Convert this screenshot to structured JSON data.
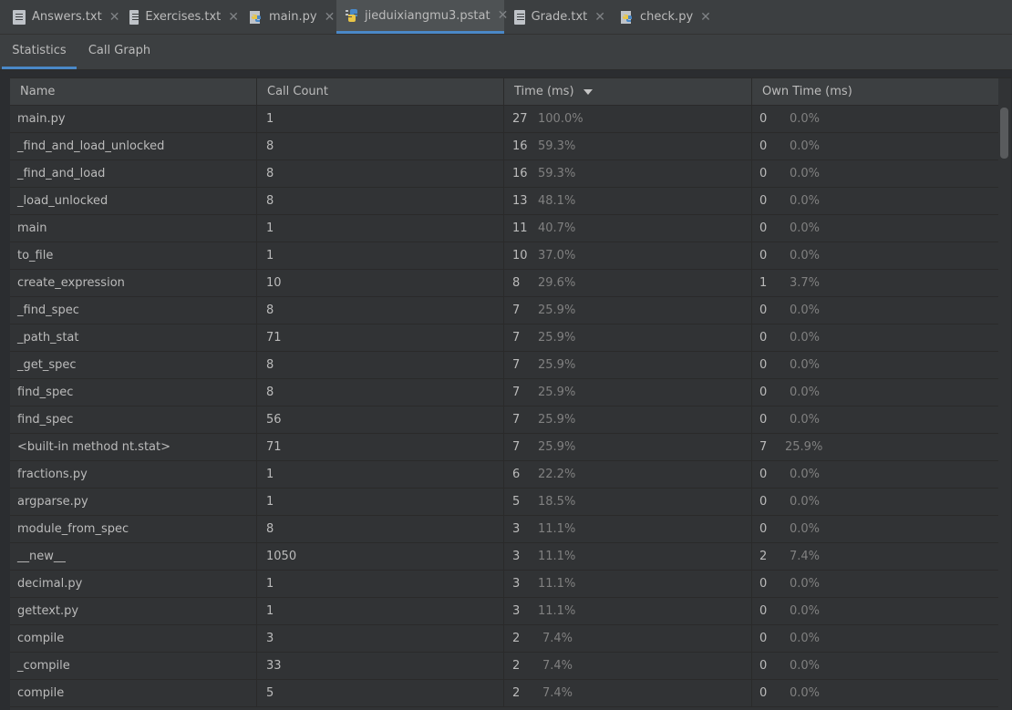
{
  "editor_tabs": [
    {
      "label": "Answers.txt",
      "icon": "text-file-icon"
    },
    {
      "label": "Exercises.txt",
      "icon": "text-file-icon"
    },
    {
      "label": "main.py",
      "icon": "python-file-icon"
    },
    {
      "label": "jieduixiangmu3.pstat",
      "icon": "python-profile-icon",
      "active": true
    },
    {
      "label": "Grade.txt",
      "icon": "text-file-icon"
    },
    {
      "label": "check.py",
      "icon": "python-file-icon"
    }
  ],
  "close_glyph": "✕",
  "view_tabs": [
    {
      "label": "Statistics",
      "active": true
    },
    {
      "label": "Call Graph",
      "active": false
    }
  ],
  "table": {
    "columns": [
      "Name",
      "Call Count",
      "Time (ms)",
      "Own Time (ms)"
    ],
    "sorted_column": "Time (ms)",
    "sort_direction": "descending",
    "rows": [
      {
        "name": "main.py",
        "calls": "1",
        "time": "27",
        "time_pct": "100.0%",
        "own": "0",
        "own_pct": "0.0%"
      },
      {
        "name": "_find_and_load_unlocked",
        "calls": "8",
        "time": "16",
        "time_pct": "59.3%",
        "own": "0",
        "own_pct": "0.0%"
      },
      {
        "name": "_find_and_load",
        "calls": "8",
        "time": "16",
        "time_pct": "59.3%",
        "own": "0",
        "own_pct": "0.0%"
      },
      {
        "name": "_load_unlocked",
        "calls": "8",
        "time": "13",
        "time_pct": "48.1%",
        "own": "0",
        "own_pct": "0.0%"
      },
      {
        "name": "main",
        "calls": "1",
        "time": "11",
        "time_pct": "40.7%",
        "own": "0",
        "own_pct": "0.0%"
      },
      {
        "name": "to_file",
        "calls": "1",
        "time": "10",
        "time_pct": "37.0%",
        "own": "0",
        "own_pct": "0.0%"
      },
      {
        "name": "create_expression",
        "calls": "10",
        "time": "8",
        "time_pct": "29.6%",
        "own": "1",
        "own_pct": "3.7%"
      },
      {
        "name": "_find_spec",
        "calls": "8",
        "time": "7",
        "time_pct": "25.9%",
        "own": "0",
        "own_pct": "0.0%"
      },
      {
        "name": "_path_stat",
        "calls": "71",
        "time": "7",
        "time_pct": "25.9%",
        "own": "0",
        "own_pct": "0.0%"
      },
      {
        "name": "_get_spec",
        "calls": "8",
        "time": "7",
        "time_pct": "25.9%",
        "own": "0",
        "own_pct": "0.0%"
      },
      {
        "name": "find_spec",
        "calls": "8",
        "time": "7",
        "time_pct": "25.9%",
        "own": "0",
        "own_pct": "0.0%"
      },
      {
        "name": "find_spec",
        "calls": "56",
        "time": "7",
        "time_pct": "25.9%",
        "own": "0",
        "own_pct": "0.0%"
      },
      {
        "name": "<built-in method nt.stat>",
        "calls": "71",
        "time": "7",
        "time_pct": "25.9%",
        "own": "7",
        "own_pct": "25.9%"
      },
      {
        "name": "fractions.py",
        "calls": "1",
        "time": "6",
        "time_pct": "22.2%",
        "own": "0",
        "own_pct": "0.0%"
      },
      {
        "name": "argparse.py",
        "calls": "1",
        "time": "5",
        "time_pct": "18.5%",
        "own": "0",
        "own_pct": "0.0%"
      },
      {
        "name": "module_from_spec",
        "calls": "8",
        "time": "3",
        "time_pct": "11.1%",
        "own": "0",
        "own_pct": "0.0%"
      },
      {
        "name": "__new__",
        "calls": "1050",
        "time": "3",
        "time_pct": "11.1%",
        "own": "2",
        "own_pct": "7.4%"
      },
      {
        "name": "decimal.py",
        "calls": "1",
        "time": "3",
        "time_pct": "11.1%",
        "own": "0",
        "own_pct": "0.0%"
      },
      {
        "name": "gettext.py",
        "calls": "1",
        "time": "3",
        "time_pct": "11.1%",
        "own": "0",
        "own_pct": "0.0%"
      },
      {
        "name": "compile",
        "calls": "3",
        "time": "2",
        "time_pct": "7.4%",
        "own": "0",
        "own_pct": "0.0%"
      },
      {
        "name": "_compile",
        "calls": "33",
        "time": "2",
        "time_pct": "7.4%",
        "own": "0",
        "own_pct": "0.0%"
      },
      {
        "name": "compile",
        "calls": "5",
        "time": "2",
        "time_pct": "7.4%",
        "own": "0",
        "own_pct": "0.0%"
      }
    ]
  },
  "colors": {
    "background": "#2b2d30",
    "tab_bar": "#3c3f41",
    "active_tab": "#4e5254",
    "accent": "#4a88c7",
    "text": "#bbbbbb",
    "percent_text": "#808080"
  }
}
